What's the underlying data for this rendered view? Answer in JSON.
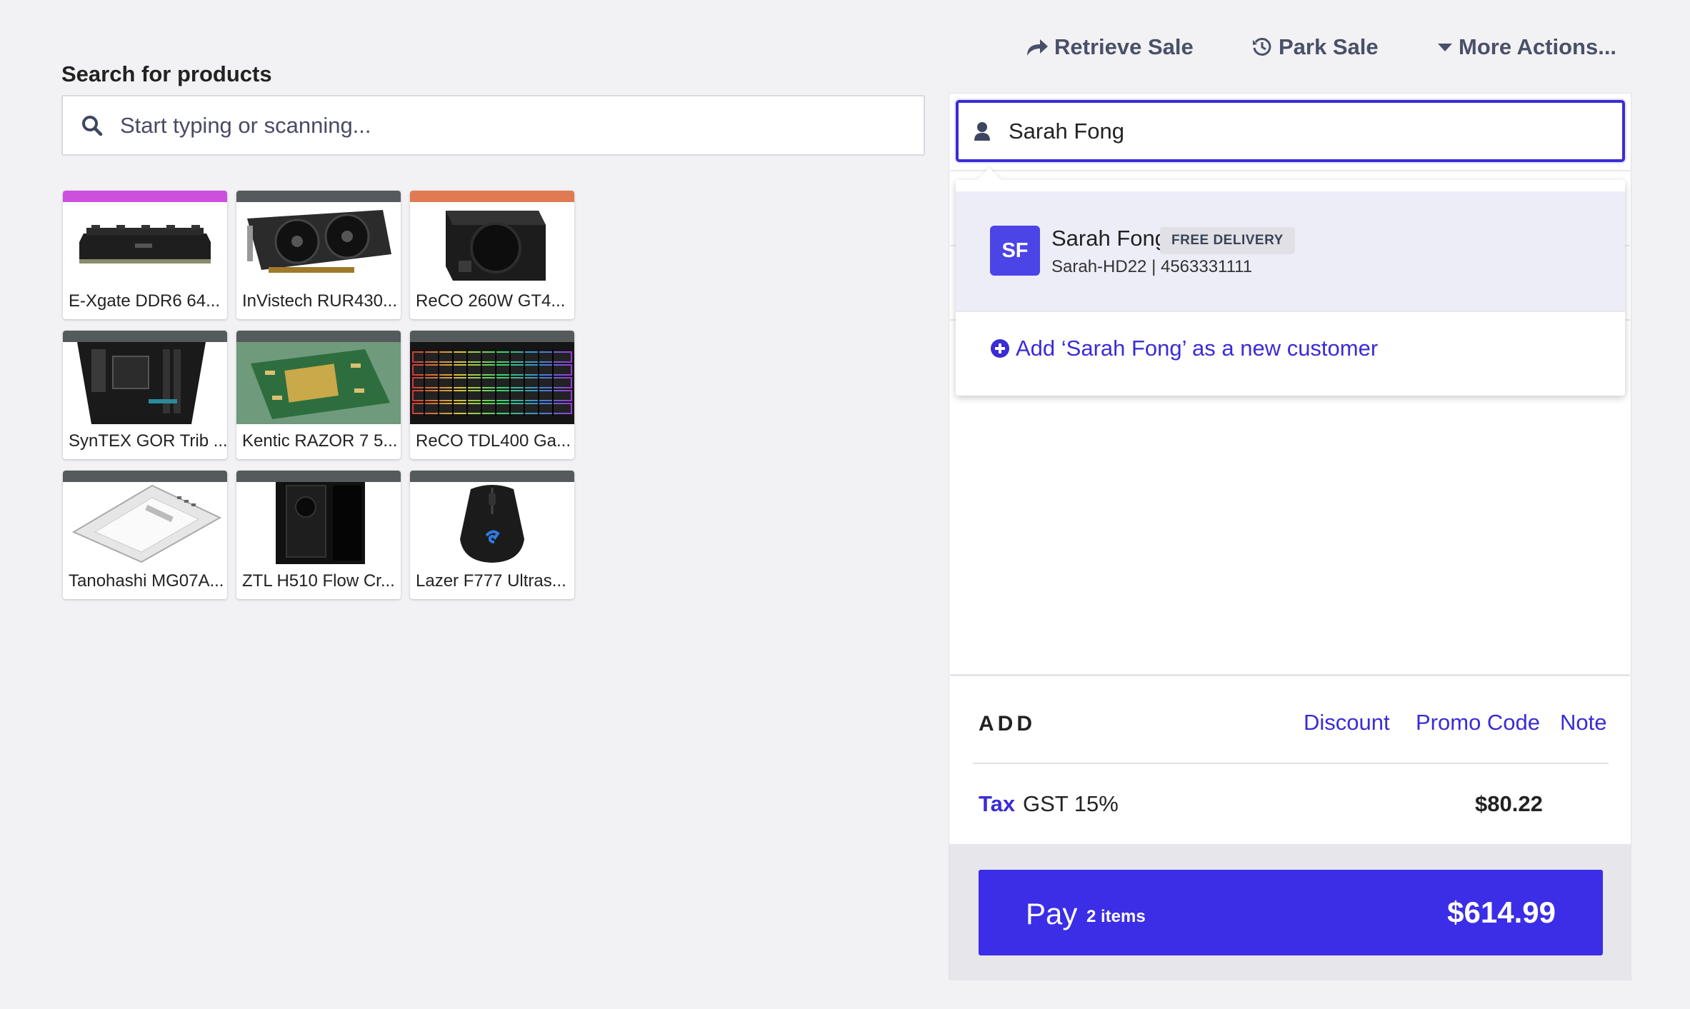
{
  "search": {
    "label": "Search for products",
    "placeholder": "Start typing or scanning..."
  },
  "header_actions": [
    {
      "label": "Retrieve Sale",
      "icon": "share-arrow-icon"
    },
    {
      "label": "Park Sale",
      "icon": "history-icon"
    },
    {
      "label": "More Actions...",
      "icon": "caret-down-icon"
    }
  ],
  "products": [
    {
      "name": "E-Xgate DDR6 64...",
      "bar_color": "#cd4fde",
      "icon": "ram-image"
    },
    {
      "name": "InVistech RUR430...",
      "bar_color": "#555a5c",
      "icon": "gpu-image"
    },
    {
      "name": "ReCO 260W GT4...",
      "bar_color": "#e07a52",
      "icon": "psu-image"
    },
    {
      "name": "SynTEX GOR Trib ...",
      "bar_color": "#555a5c",
      "icon": "motherboard-image"
    },
    {
      "name": "Kentic RAZOR 7 5...",
      "bar_color": "#555a5c",
      "icon": "cpu-image"
    },
    {
      "name": "ReCO TDL400 Ga...",
      "bar_color": "#555a5c",
      "icon": "keyboard-image"
    },
    {
      "name": "Tanohashi MG07A...",
      "bar_color": "#555a5c",
      "icon": "hdd-image"
    },
    {
      "name": "ZTL H510 Flow Cr...",
      "bar_color": "#555a5c",
      "icon": "case-image"
    },
    {
      "name": "Lazer F777 Ultras...",
      "bar_color": "#555a5c",
      "icon": "mouse-image"
    }
  ],
  "customer": {
    "input_value": "Sarah Fong",
    "result": {
      "initials": "SF",
      "name": "Sarah Fong",
      "badge": "FREE DELIVERY",
      "meta": "Sarah-HD22 | 4563331111"
    },
    "add_new_label": "Add ‘Sarah Fong’ as a new customer"
  },
  "add_section": {
    "title": "ADD",
    "links": [
      "Discount",
      "Promo Code",
      "Note"
    ]
  },
  "tax": {
    "link": "Tax",
    "name": "GST 15%",
    "amount": "$80.22"
  },
  "pay": {
    "label": "Pay",
    "items": "2 items",
    "amount": "$614.99"
  },
  "colors": {
    "accent": "#3b2ee6",
    "background": "#f2f1f4",
    "muted_text": "#4a5068"
  }
}
